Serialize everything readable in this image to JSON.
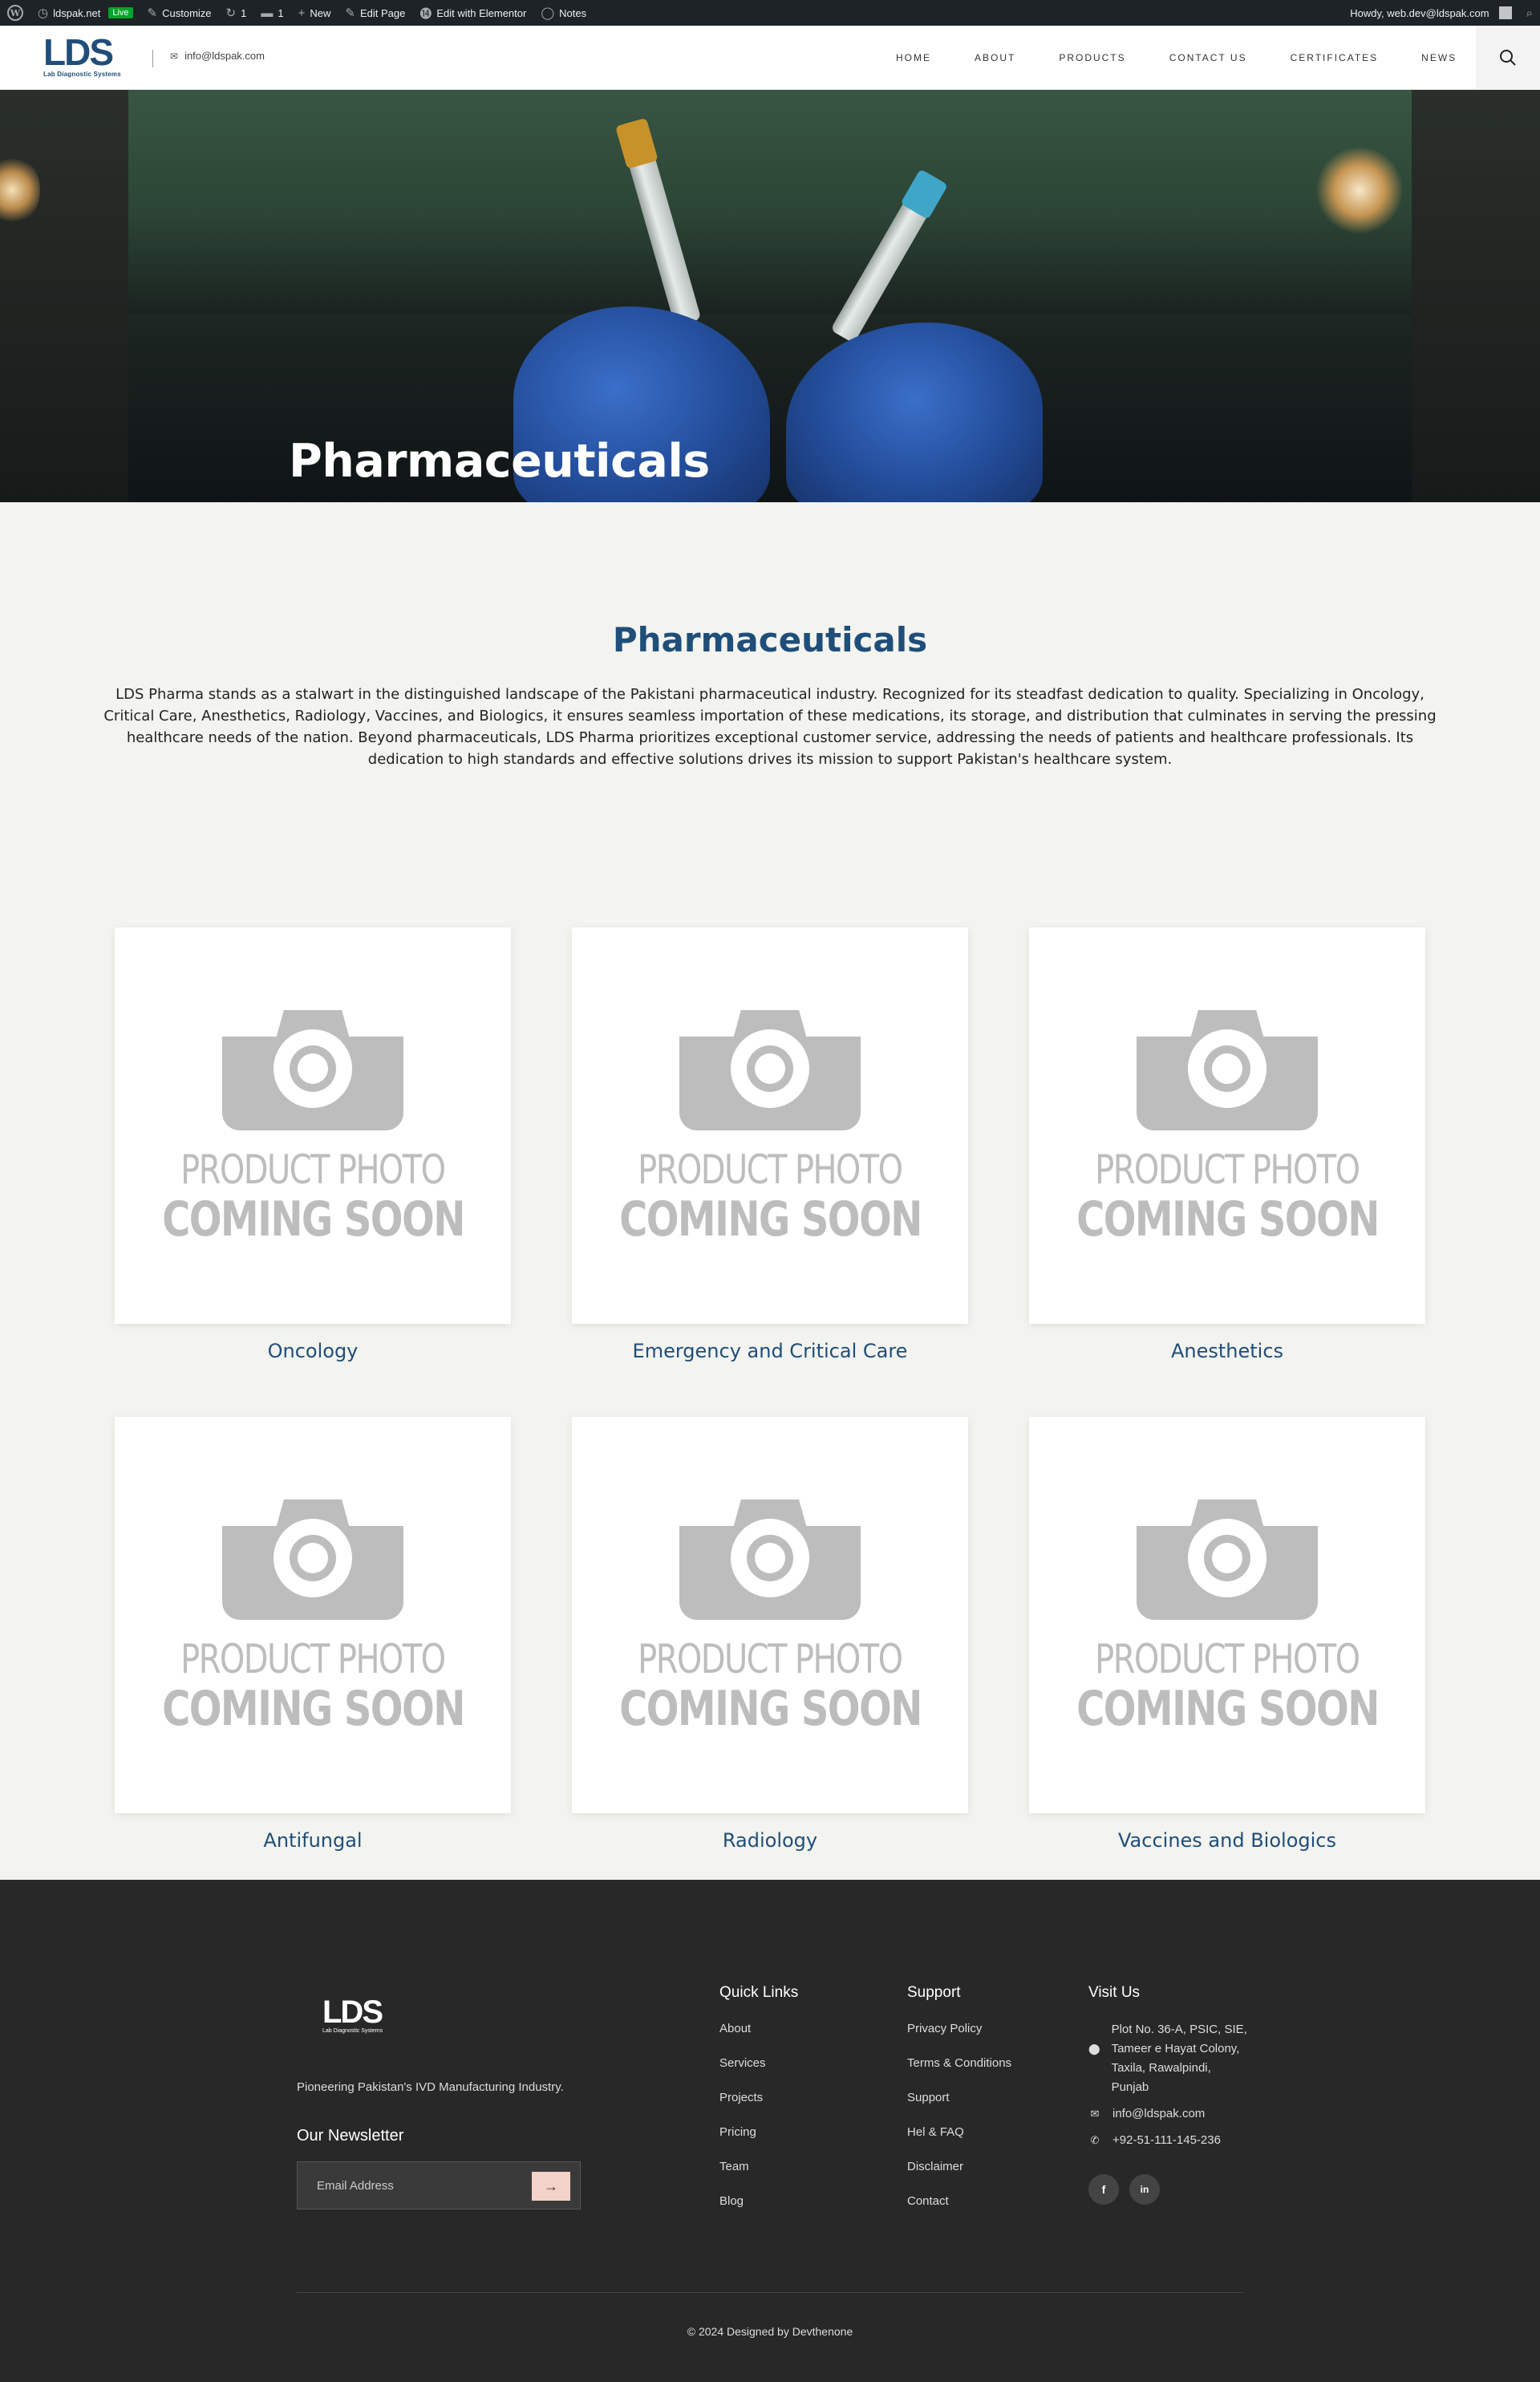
{
  "admin_bar": {
    "site_name": "ldspak.net",
    "live_badge": "Live",
    "customize": "Customize",
    "updates_count": "1",
    "comments_count": "1",
    "new": "New",
    "edit_page": "Edit Page",
    "edit_elementor": "Edit with Elementor",
    "notes": "Notes",
    "howdy": "Howdy, web.dev@ldspak.com"
  },
  "header": {
    "logo_text": "LDS",
    "logo_sub": "Lab Diagnostic Systems",
    "email": "info@ldspak.com",
    "nav": [
      "HOME",
      "ABOUT",
      "PRODUCTS",
      "CONTACT US",
      "CERTIFICATES",
      "NEWS"
    ]
  },
  "hero": {
    "title": "Pharmaceuticals"
  },
  "intro": {
    "title": "Pharmaceuticals",
    "text": "LDS Pharma stands as a stalwart in the distinguished landscape of the Pakistani pharmaceutical industry. Recognized for its steadfast dedication to quality. Specializing in Oncology, Critical Care, Anesthetics, Radiology, Vaccines, and Biologics, it ensures seamless importation of these medications, its storage, and distribution that culminates in serving the pressing healthcare needs of the nation. Beyond pharmaceuticals, LDS Pharma prioritizes exceptional customer service, addressing the needs of patients and healthcare professionals. Its dedication to high standards and effective solutions drives its mission to support Pakistan's healthcare system."
  },
  "placeholder": {
    "line1": "PRODUCT PHOTO",
    "line2": "COMING SOON"
  },
  "products": [
    {
      "label": "Oncology"
    },
    {
      "label": "Emergency and Critical Care"
    },
    {
      "label": "Anesthetics"
    },
    {
      "label": "Antifungal"
    },
    {
      "label": "Radiology"
    },
    {
      "label": "Vaccines and Biologics"
    }
  ],
  "footer": {
    "logo_text": "LDS",
    "logo_sub": "Lab Diagnostic Systems",
    "tagline": "Pioneering Pakistan's IVD Manufacturing Industry.",
    "newsletter_title": "Our Newsletter",
    "newsletter_placeholder": "Email Address",
    "quick_links_title": "Quick Links",
    "quick_links": [
      "About",
      "Services",
      "Projects",
      "Pricing",
      "Team",
      "Blog"
    ],
    "support_title": "Support",
    "support_links": [
      "Privacy Policy",
      "Terms & Conditions",
      "Support",
      "Hel & FAQ",
      "Disclaimer",
      "Contact"
    ],
    "visit_title": "Visit Us",
    "address": "Plot No. 36-A, PSIC, SIE, Tameer e Hayat Colony, Taxila, Rawalpindi, Punjab",
    "email": "info@ldspak.com",
    "phone": "+92-51-111-145-236",
    "social": [
      "f",
      "in"
    ],
    "copyright": "© 2024 Designed by Devthenone"
  },
  "colors": {
    "brand_blue": "#1f4e79",
    "footer_bg": "#282828",
    "page_bg": "#f3f3ef",
    "newsletter_btn": "#f3d2c7"
  }
}
